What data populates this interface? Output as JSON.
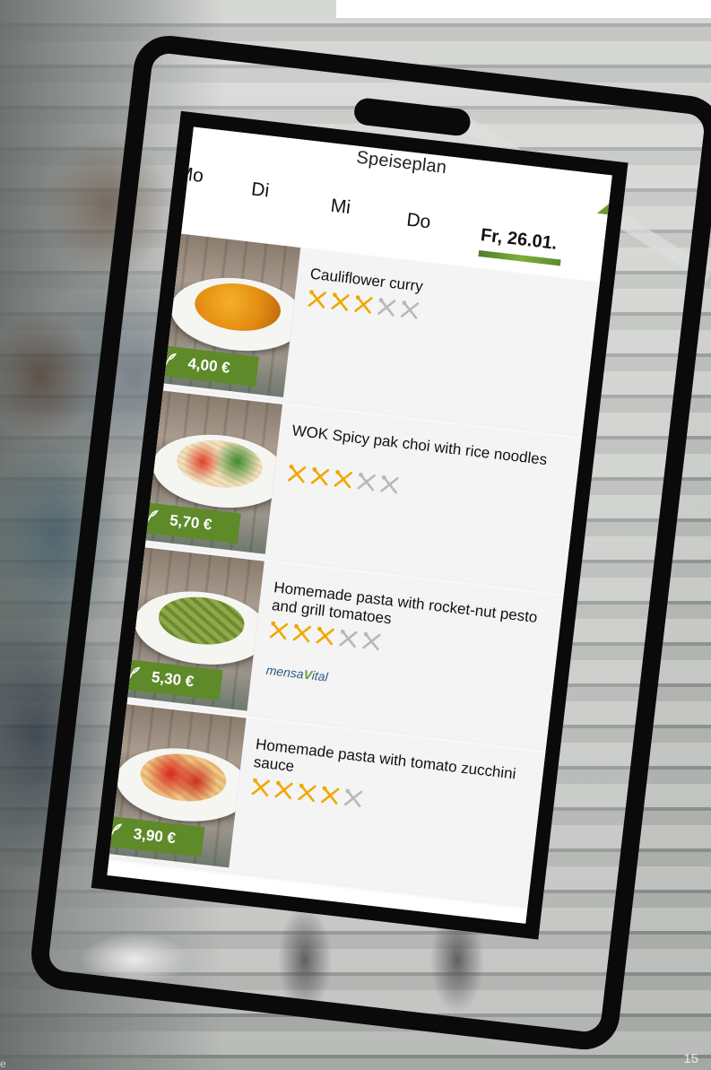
{
  "page": {
    "number": "15",
    "corner_mark": "e"
  },
  "app": {
    "title": "Speiseplan",
    "days": [
      "Mo",
      "Di",
      "Mi",
      "Do"
    ],
    "active_day": "Fr, 26.01.",
    "accent_color": "#5f8a2a"
  },
  "menu": [
    {
      "name": "Cauliflower curry",
      "price": "4,00 €",
      "rating": 3,
      "rating_max": 5,
      "vegetarian": true,
      "logo": ""
    },
    {
      "name": "WOK Spicy pak choi with rice noodles",
      "price": "5,70 €",
      "rating": 3,
      "rating_max": 5,
      "vegetarian": true,
      "logo": ""
    },
    {
      "name": "Homemade pasta  with rocket-nut pesto and grill tomatoes",
      "price": "5,30 €",
      "rating": 3,
      "rating_max": 5,
      "vegetarian": true,
      "logo": "mensaVital"
    },
    {
      "name": "Homemade pasta  with tomato zucchini sauce",
      "price": "3,90 €",
      "rating": 4,
      "rating_max": 5,
      "vegetarian": true,
      "logo": ""
    }
  ],
  "icons": {
    "leaf": "leaf-icon",
    "rating": "cutlery-icon"
  }
}
